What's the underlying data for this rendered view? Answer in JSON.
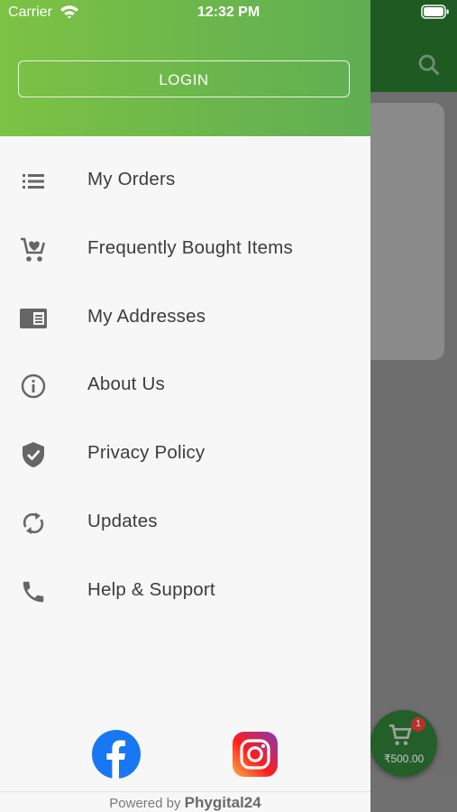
{
  "status_bar": {
    "carrier": "Carrier",
    "time": "12:32 PM"
  },
  "drawer": {
    "login_label": "LOGIN",
    "menu": [
      {
        "label": "My Orders",
        "icon": "list-icon"
      },
      {
        "label": "Frequently Bought Items",
        "icon": "cart-heart-icon"
      },
      {
        "label": "My Addresses",
        "icon": "address-card-icon"
      },
      {
        "label": "About Us",
        "icon": "info-icon"
      },
      {
        "label": "Privacy Policy",
        "icon": "shield-check-icon"
      },
      {
        "label": "Updates",
        "icon": "sync-icon"
      },
      {
        "label": "Help & Support",
        "icon": "phone-icon"
      }
    ],
    "footer": {
      "powered_by": "Powered by",
      "brand": "Phygital24"
    }
  },
  "cart": {
    "badge": "1",
    "amount": "₹500.00"
  },
  "colors": {
    "header_green_start": "#7cc244",
    "header_green_end": "#5fae52",
    "app_header": "#1f5a22"
  }
}
